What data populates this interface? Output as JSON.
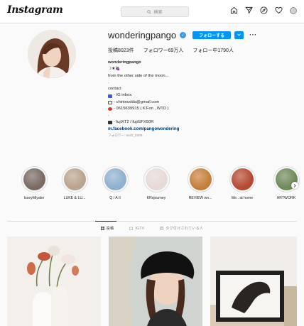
{
  "topbar": {
    "logo": "Instagram",
    "search_placeholder": "検索",
    "icons": [
      "home-icon",
      "direct-icon",
      "explore-icon",
      "heart-icon",
      "profile-avatar-icon"
    ]
  },
  "profile": {
    "username": "wonderingpango",
    "follow_label": "フォローする",
    "posts": "投稿8023件",
    "followers": "フォロワー69万人",
    "following": "フォロー中1790人",
    "bio": {
      "name": "wonderingpango",
      "line1": "☽★🍇",
      "line2": "from the other side of the moon...",
      "line3": ".",
      "line4": "contact",
      "line5": "- IG inbox",
      "line6": "- chintnudda@gmail.com",
      "line7": "- 0615639915 ( K'Fon , WTD )",
      "line8": ".",
      "line9": "- fujiXT2 / fujiGFX50R",
      "link": "m.facebook.com/pangowondering",
      "followed_by": "フォロワー: toofz_0206"
    }
  },
  "highlights": [
    {
      "label": "IsseyMiyake",
      "color": "#7a6a62"
    },
    {
      "label": "LUKE & LU...",
      "color": "#b9a48d"
    },
    {
      "label": "Q / A II",
      "color": "#8fb0cf"
    },
    {
      "label": "KRsjourney",
      "color": "#e7d9d6"
    },
    {
      "label": "REVIEW wn...",
      "color": "#c67f3a"
    },
    {
      "label": "Me.. at home",
      "color": "#b54a32"
    },
    {
      "label": "ARTWORK",
      "color": "#6f8a5a"
    }
  ],
  "tabs": [
    {
      "label": "投稿",
      "icon": "grid-icon"
    },
    {
      "label": "IGTV",
      "icon": "igtv-icon"
    },
    {
      "label": "タグ付けされている人",
      "icon": "tagged-icon"
    }
  ],
  "colors": {
    "accent": "#0095f6",
    "link": "#00376b",
    "muted": "#8e8e8e",
    "border": "#dbdbdb"
  }
}
